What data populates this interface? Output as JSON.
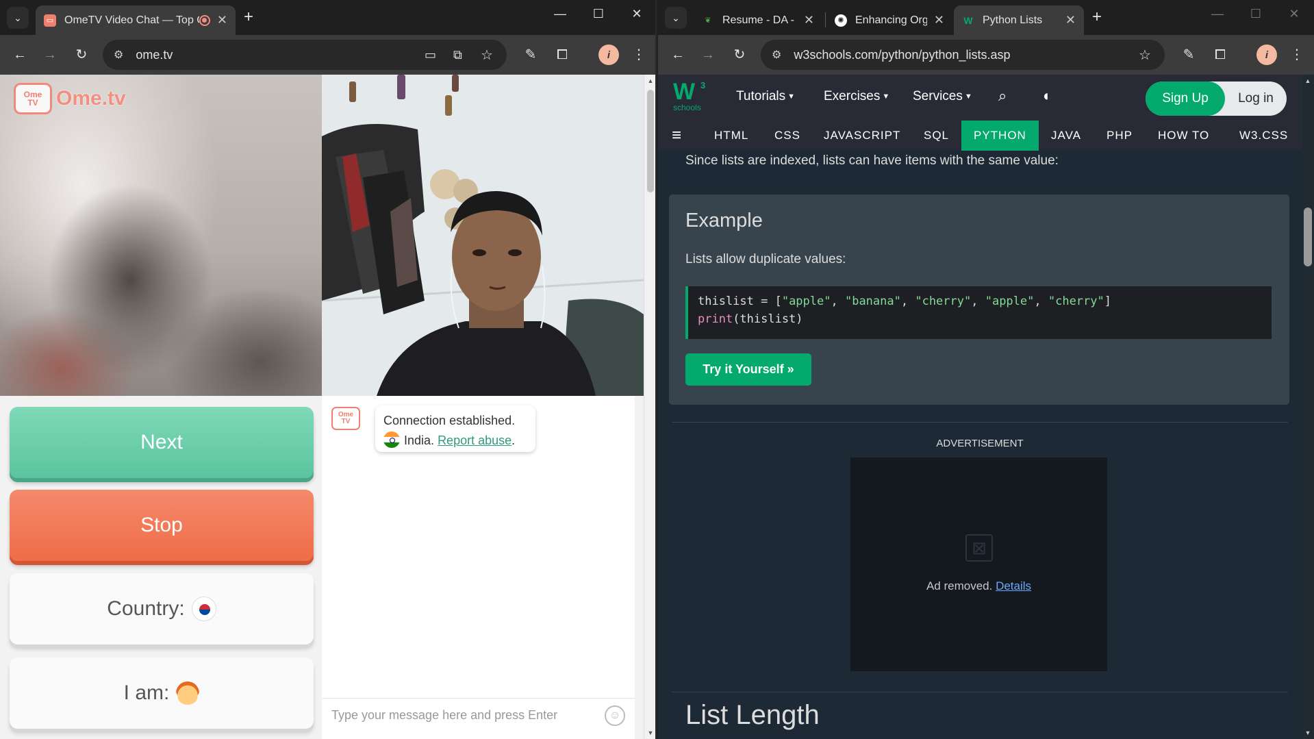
{
  "left_window": {
    "tab": {
      "title": "OmeTV Video Chat — Top Chatroulette Alternative",
      "recording_icon": "record-icon"
    },
    "address": "ome.tv",
    "controls": {
      "minimize": "—",
      "maximize": "☐",
      "close": "✕"
    },
    "page": {
      "logo": {
        "badge_top": "Ome",
        "badge_bottom": "TV",
        "text": "Ome.tv"
      },
      "buttons": {
        "next": "Next",
        "stop": "Stop",
        "country": "Country:",
        "iam": "I am:"
      },
      "chat": {
        "status": "Connection established.",
        "country": "India.",
        "report_link": "Report abuse",
        "report_suffix": ".",
        "input_placeholder": "Type your message here and press Enter"
      }
    }
  },
  "right_window": {
    "tabs": [
      {
        "title": "Resume - DA - Online",
        "favicon": "overleaf-icon"
      },
      {
        "title": "Enhancing Organic",
        "favicon": "chatgpt-icon"
      },
      {
        "title": "Python Lists",
        "favicon": "w3schools-icon"
      }
    ],
    "address": "w3schools.com/python/python_lists.asp",
    "page": {
      "logo": {
        "mark": "W",
        "sup": "3",
        "sub": "schools"
      },
      "topnav": [
        "Tutorials",
        "Exercises",
        "Services"
      ],
      "signup": "Sign Up",
      "login": "Log in",
      "subnav": [
        "HTML",
        "CSS",
        "JAVASCRIPT",
        "SQL",
        "PYTHON",
        "JAVA",
        "PHP",
        "HOW TO",
        "W3.CSS"
      ],
      "subnav_active": "PYTHON",
      "intro": "Since lists are indexed, lists can have items with the same value:",
      "example": {
        "title": "Example",
        "subtitle": "Lists allow duplicate values:",
        "code_line1": "thislist = [\"apple\", \"banana\", \"cherry\", \"apple\", \"cherry\"]",
        "code_line2": "print(thislist)",
        "try_button": "Try it Yourself »"
      },
      "ad": {
        "label": "ADVERTISEMENT",
        "text": "Ad removed.",
        "details": "Details"
      },
      "next_heading": "List Length"
    }
  },
  "colors": {
    "w3_green": "#04aa6d",
    "ome_next": "#5bc49f",
    "ome_stop": "#ef6c48",
    "ome_brand": "#ef7f6e"
  }
}
